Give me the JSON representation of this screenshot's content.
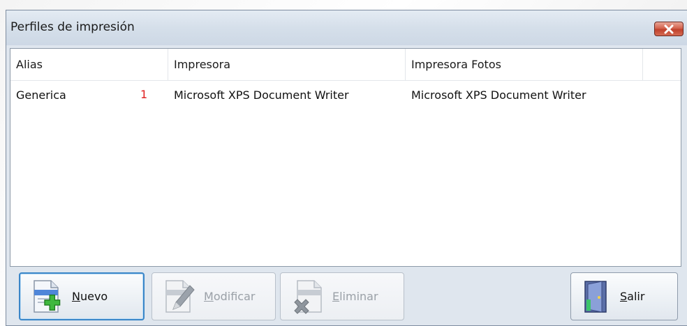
{
  "window": {
    "title": "Perfiles de impresión",
    "close_icon": "close-icon"
  },
  "grid": {
    "columns": [
      "Alias",
      "Impresora",
      "Impresora Fotos"
    ],
    "rows": [
      {
        "alias": "Generica",
        "badge": "1",
        "printer": "Microsoft XPS Document Writer",
        "photo_printer": "Microsoft XPS Document Writer"
      }
    ]
  },
  "buttons": {
    "new": {
      "accel": "N",
      "rest": "uevo",
      "icon": "document-add-icon",
      "enabled": true
    },
    "modify": {
      "accel": "M",
      "rest": "odificar",
      "icon": "document-edit-icon",
      "enabled": false
    },
    "delete": {
      "accel": "E",
      "rest": "liminar",
      "icon": "document-delete-icon",
      "enabled": false
    },
    "exit": {
      "accel": "S",
      "rest": "alir",
      "icon": "exit-door-icon",
      "enabled": true
    }
  },
  "colors": {
    "title_bar": "#d5dfea",
    "close_button": "#c0412c",
    "badge": "#e02020",
    "primary_border": "#3a86c8"
  }
}
